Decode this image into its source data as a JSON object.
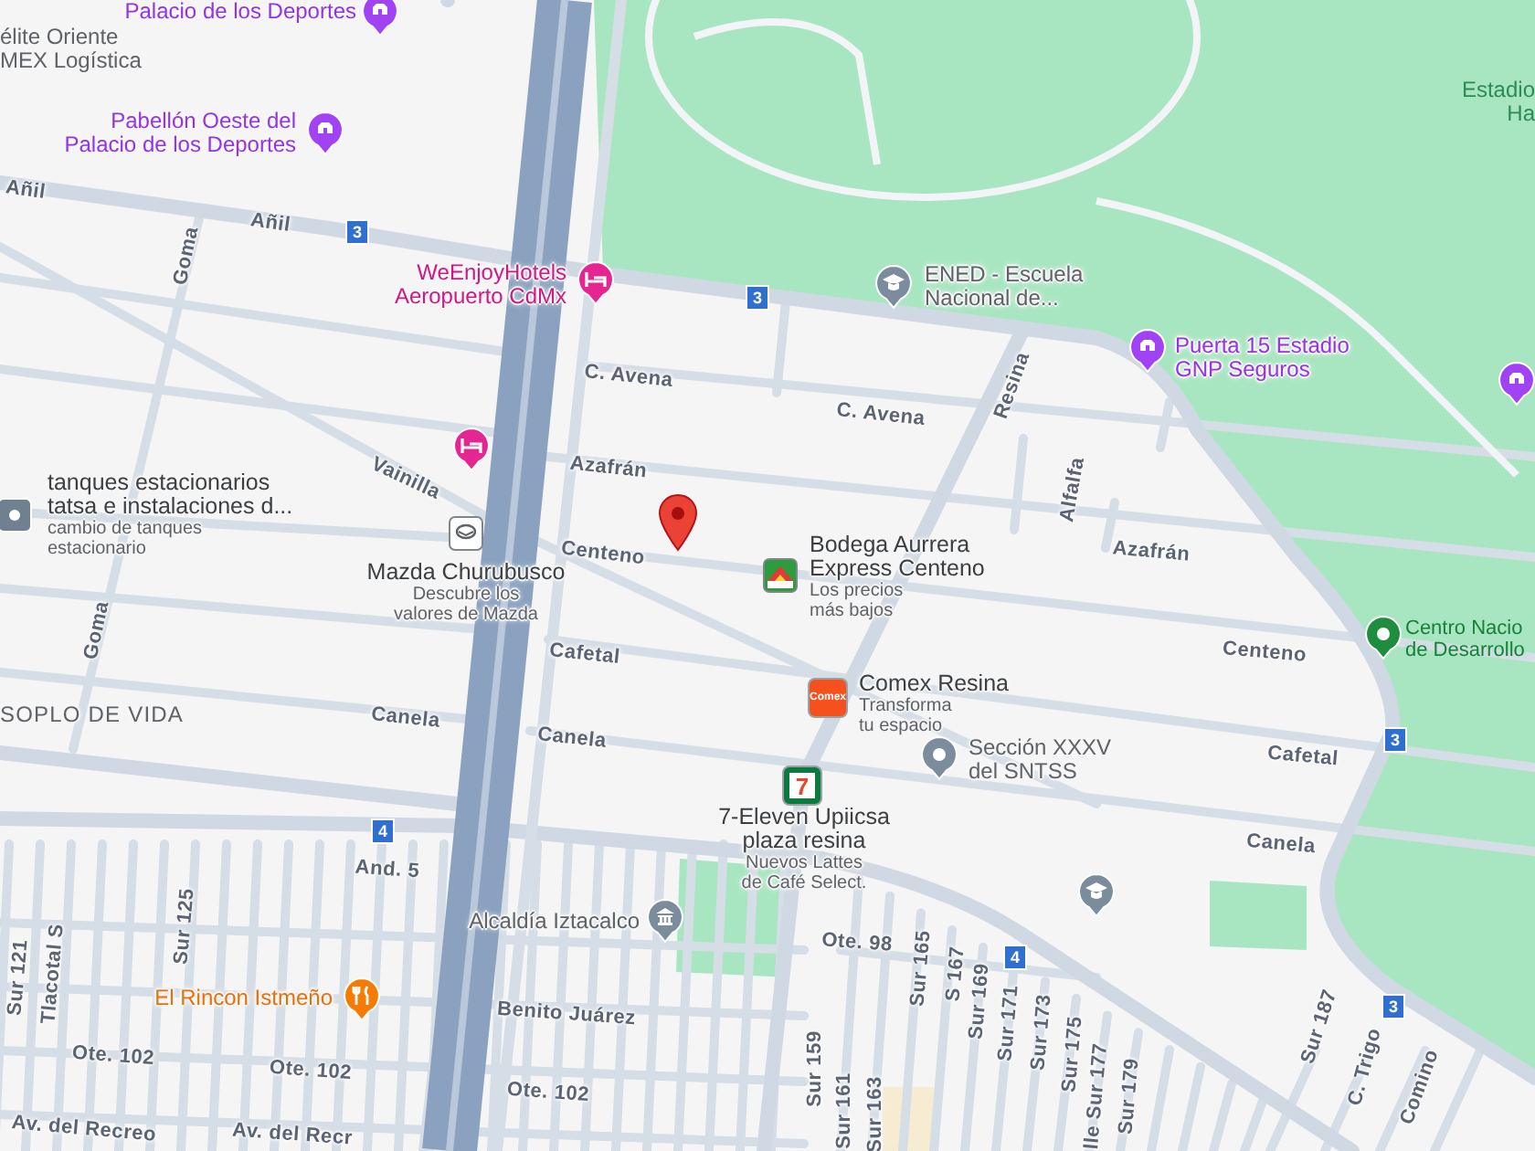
{
  "map": {
    "street_labels": [
      {
        "text": "Añil"
      },
      {
        "text": "Añil"
      },
      {
        "text": "Goma"
      },
      {
        "text": "Vainilla"
      },
      {
        "text": "C. Avena"
      },
      {
        "text": "C. Avena"
      },
      {
        "text": "Resina"
      },
      {
        "text": "Azafrán"
      },
      {
        "text": "Alfalfa"
      },
      {
        "text": "Azafrán"
      },
      {
        "text": "Centeno"
      },
      {
        "text": "Centeno"
      },
      {
        "text": "Cafetal"
      },
      {
        "text": "Cafetal"
      },
      {
        "text": "Goma"
      },
      {
        "text": "Canela"
      },
      {
        "text": "Canela"
      },
      {
        "text": "Canela"
      },
      {
        "text": "And. 5"
      },
      {
        "text": "Sur 121"
      },
      {
        "text": "Tlacotal S"
      },
      {
        "text": "Sur 125"
      },
      {
        "text": "Benito Juárez"
      },
      {
        "text": "Ote. 98"
      },
      {
        "text": "Sur 165"
      },
      {
        "text": "S 167"
      },
      {
        "text": "Sur 169"
      },
      {
        "text": "Sur 171"
      },
      {
        "text": "Sur 159"
      },
      {
        "text": "Sur 161"
      },
      {
        "text": "Sur 163"
      },
      {
        "text": "Sur 173"
      },
      {
        "text": "Sur 175"
      },
      {
        "text": "lle Sur 177"
      },
      {
        "text": "Sur 179"
      },
      {
        "text": "Sur 187"
      },
      {
        "text": "C. Trigo"
      },
      {
        "text": "Comino"
      },
      {
        "text": "Ote. 102"
      },
      {
        "text": "Ote. 102"
      },
      {
        "text": "Ote. 102"
      },
      {
        "text": "Av. del Recreo"
      },
      {
        "text": "Av. del Recr"
      }
    ],
    "places": [
      {
        "kind": "sports",
        "name": "Palacio de los Deportes"
      },
      {
        "kind": "business",
        "name": "élite Oriente\nMEX Logística"
      },
      {
        "kind": "sports",
        "name": "Pabellón Oeste del\nPalacio de los Deportes"
      },
      {
        "kind": "hotel",
        "name": "WeEnjoyHotels\nAeropuerto CdMx"
      },
      {
        "kind": "hotel"
      },
      {
        "kind": "school",
        "name": "ENED - Escuela\nNacional de..."
      },
      {
        "kind": "sports",
        "name": "Puerta 15 Estadio\nGNP Seguros"
      },
      {
        "kind": "sports"
      },
      {
        "kind": "parklabel",
        "name": "Estadio\nHa"
      },
      {
        "kind": "store",
        "name": "tanques estacionarios\ntatsa e instalaciones d...",
        "subtitle": "cambio de tanques\nestacionario"
      },
      {
        "kind": "outlinelogo",
        "name": "Mazda Churubusco",
        "subtitle": "Descubre los\nvalores de Mazda"
      },
      {
        "kind": "rooflogo",
        "name": "Bodega Aurrera\nExpress Centeno",
        "subtitle": "Los precios\nmás bajos"
      },
      {
        "kind": "textlogo",
        "name": "Comex Resina",
        "subtitle": "Transforma\ntu espacio",
        "logo_text": "Comex",
        "color": "#f4511e"
      },
      {
        "kind": "landmark",
        "name": "Sección XXXV\ndel SNTSS"
      },
      {
        "kind": "framelogo",
        "name": "7-Eleven Upiicsa\nplaza resina",
        "subtitle": "Nuevos Lattes\nde Café Select.",
        "logo_text": "7",
        "color": "#ffffff"
      },
      {
        "kind": "government",
        "name": "Alcaldía Iztacalco"
      },
      {
        "kind": "restaurant",
        "name": "El Rincon Istmeño"
      },
      {
        "kind": "area",
        "name": "SOPLO DE VIDA"
      },
      {
        "kind": "park",
        "name": "Centro Nacio\nde Desarrollo"
      },
      {
        "kind": "school"
      }
    ],
    "route_shields": [
      {
        "label": "3"
      },
      {
        "label": "3"
      },
      {
        "label": "3"
      },
      {
        "label": "3"
      },
      {
        "label": "4"
      },
      {
        "label": "4"
      }
    ]
  }
}
